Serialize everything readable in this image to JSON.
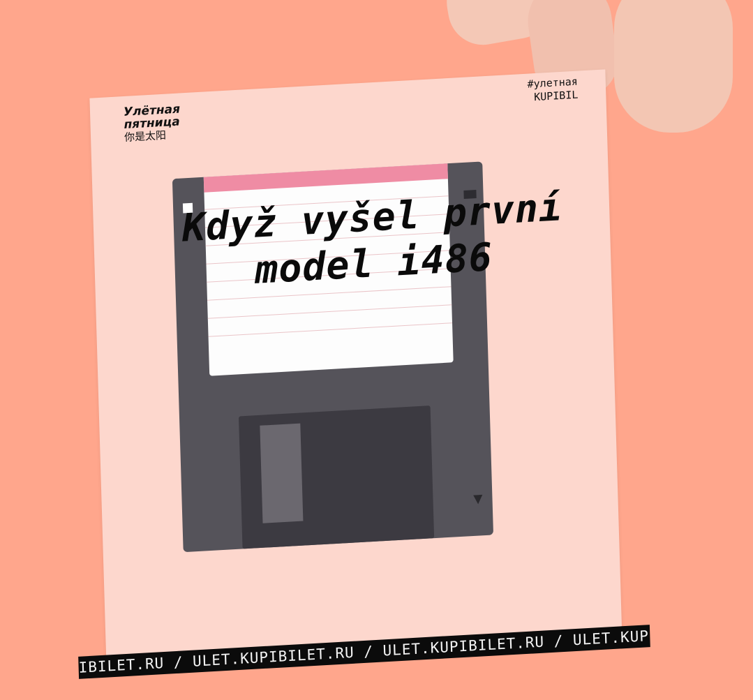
{
  "card": {
    "brand_line1": "Улётная",
    "brand_line2": "пятница",
    "brand_line3": "你是太阳",
    "tag_line1": "#улетная",
    "tag_line2": "KUPIBIL",
    "headline_line1": "Když vyšel první",
    "headline_line2": "model i486",
    "ticker": "IBILET.RU / ULET.KUPIBILET.RU / ULET.KUPIBILET.RU / ULET.KUPIBIL"
  },
  "colors": {
    "background": "#ffa68c",
    "card": "#fdd7cd",
    "floppy": "#55535a",
    "label_stripe": "#ef8ca4",
    "ticker": "#0b0b0b"
  },
  "icons": [
    "down-arrow-icon"
  ]
}
